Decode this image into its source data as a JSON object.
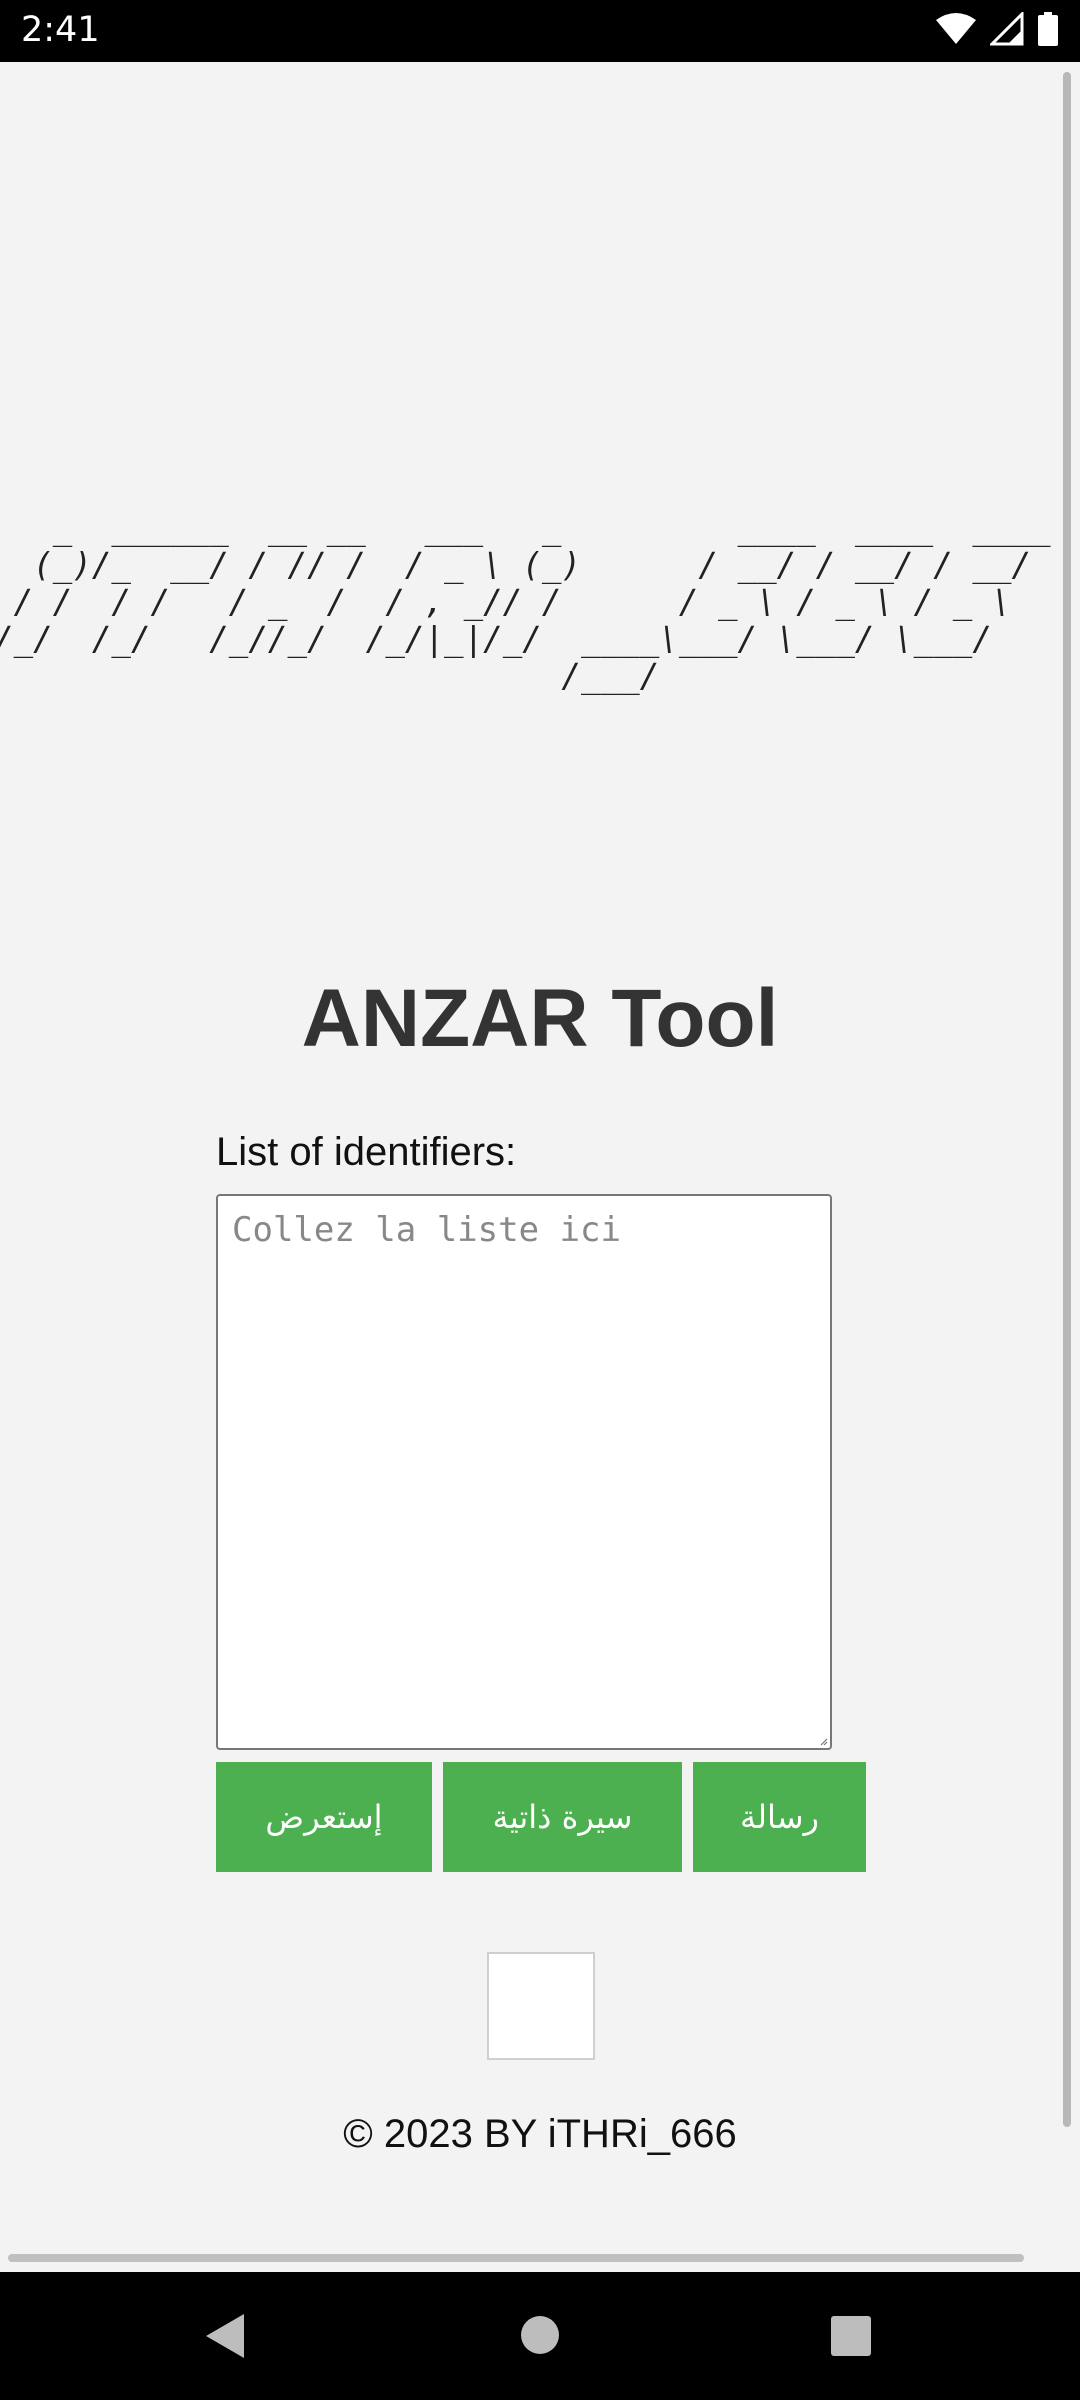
{
  "status_bar": {
    "time": "2:41",
    "icons": [
      "wifi-icon",
      "cellular-signal-icon",
      "battery-icon"
    ]
  },
  "ascii_banner": {
    "lines": [
      "   _  ______  __ __   ___   _         ____  ____  ____",
      "  (_)/_  __/ / // /  / _ \\ (_)      / __/ / __/ / __/",
      " / /  / /   / _  /  / , _// /      / _ \\ / _ \\ / _ \\",
      "/_/  /_/   /_//_/  /_/|_|/_/  ____\\___/ \\___/ \\___/",
      "                             /___/"
    ]
  },
  "main": {
    "title": "ANZAR Tool",
    "identifiers_label": "List of identifiers:",
    "identifiers_placeholder": "Collez la liste ici",
    "identifiers_value": "",
    "buttons": {
      "browse": "إستعرض",
      "cv": "سيرة ذاتية",
      "message": "رسالة"
    },
    "button_color": "#4caf50"
  },
  "footer": {
    "copyright": "© 2023 BY iTHRi_666"
  },
  "nav_bar": {
    "icons": [
      "back-icon",
      "home-icon",
      "recents-icon"
    ]
  }
}
